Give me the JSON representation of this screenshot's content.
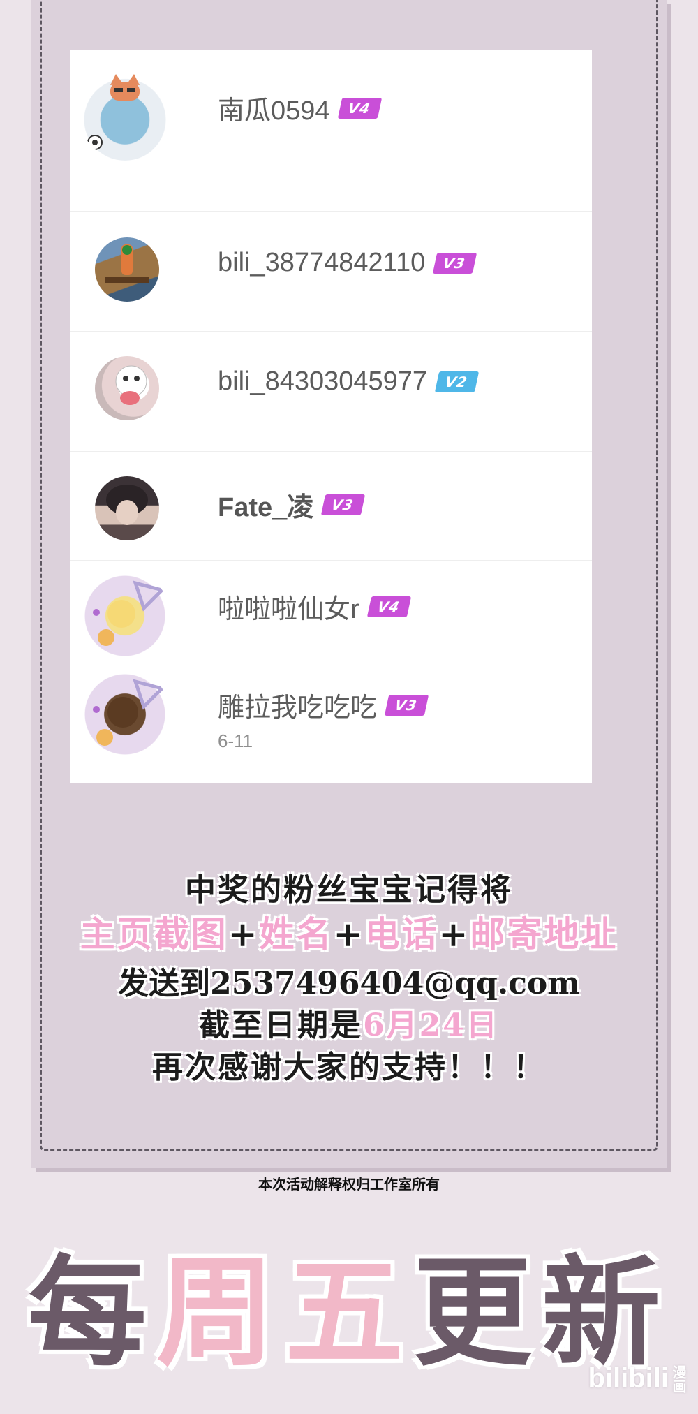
{
  "comments": [
    {
      "name": "南瓜0594",
      "level": "V4",
      "level_color": "#c94fd8"
    },
    {
      "name": "bili_38774842110",
      "level": "V3",
      "level_color": "#c94fd8"
    },
    {
      "name": "bili_84303045977",
      "level": "V2",
      "level_color": "#4fb7e8"
    },
    {
      "name": "Fate_凌",
      "level": "V3",
      "level_color": "#c94fd8"
    },
    {
      "name": "啦啦啦仙女r",
      "level": "V4",
      "level_color": "#c94fd8"
    },
    {
      "name": "雕拉我吃吃吃",
      "level": "V3",
      "level_color": "#c94fd8",
      "date": "6-11"
    }
  ],
  "notice": {
    "line1": "中奖的粉丝宝宝记得将",
    "line2_parts": [
      "主页截图",
      "+",
      "姓名",
      "+",
      "电话",
      "+",
      "邮寄地址"
    ],
    "line3": "发送到2537496404@qq.com",
    "line4_prefix": "截至日期是",
    "line4_date": "6月24日",
    "line5": "再次感谢大家的支持！！！",
    "rights": "本次活动解释权归工作室所有"
  },
  "banner": {
    "chars": [
      "每",
      "周",
      "五",
      "更",
      "新"
    ]
  },
  "watermark": {
    "brand": "bilibili",
    "sub": "漫画"
  },
  "colors": {
    "pink": "#f4a6cf",
    "panel": "#dcd1db",
    "banner_dark": "#6b5a68",
    "banner_pink": "#f2b8c8"
  }
}
